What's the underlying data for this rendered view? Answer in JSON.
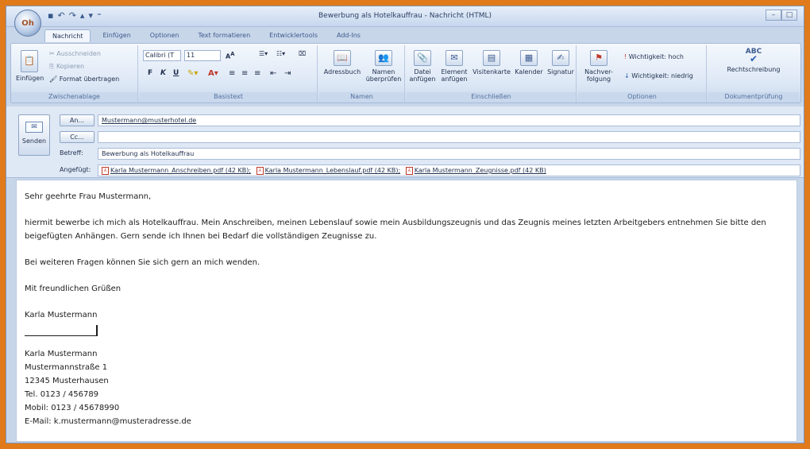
{
  "window": {
    "title": "Bewerbung als Hotelkauffrau - Nachricht (HTML)",
    "orb_label": "Oh"
  },
  "tabs": [
    "Nachricht",
    "Einfügen",
    "Optionen",
    "Text formatieren",
    "Entwicklertools",
    "Add-Ins"
  ],
  "ribbon": {
    "clipboard": {
      "paste": "Einfügen",
      "cut": "Ausschneiden",
      "copy": "Kopieren",
      "format_painter": "Format übertragen",
      "label": "Zwischenablage"
    },
    "basic_text": {
      "font_name": "Calibri (T",
      "font_size": "11",
      "bold": "F",
      "italic": "K",
      "underline": "U",
      "label": "Basistext"
    },
    "names": {
      "address_book": "Adressbuch",
      "check_names_1": "Namen",
      "check_names_2": "überprüfen",
      "label": "Namen"
    },
    "include": {
      "attach_file_1": "Datei",
      "attach_file_2": "anfügen",
      "attach_item_1": "Element",
      "attach_item_2": "anfügen",
      "business_card": "Visitenkarte",
      "calendar": "Kalender",
      "signature": "Signatur",
      "label": "Einschließen"
    },
    "options": {
      "follow_up_1": "Nachver-",
      "follow_up_2": "folgung",
      "high_importance": "Wichtigkeit: hoch",
      "low_importance": "Wichtigkeit: niedrig",
      "label": "Optionen"
    },
    "proofing": {
      "spelling": "Rechtschreibung",
      "abc": "ABC",
      "label": "Dokumentprüfung"
    }
  },
  "header": {
    "send_label": "Senden",
    "to_button": "An...",
    "cc_button": "Cc...",
    "subject_label": "Betreff:",
    "attached_label": "Angefügt:",
    "to_value": "Mustermann@musterhotel.de",
    "cc_value": "",
    "subject_value": "Bewerbung als Hotelkauffrau",
    "attachments": [
      "Karla Mustermann_Anschreiben.pdf (42 KB);",
      "Karla Mustermann_Lebenslauf.pdf (42 KB);",
      "Karla Mustermann_Zeugnisse.pdf (42 KB)"
    ]
  },
  "body": {
    "greeting": "Sehr geehrte Frau Mustermann,",
    "paragraph1": "hiermit bewerbe ich mich als Hotelkauffrau. Mein Anschreiben, meinen Lebenslauf sowie mein Ausbildungszeugnis und das Zeugnis meines letzten Arbeitgebers entnehmen Sie bitte den beigefügten Anhängen. Gern sende ich Ihnen bei Bedarf die vollständigen Zeugnisse zu.",
    "paragraph2": "Bei weiteren Fragen können Sie sich gern an mich wenden.",
    "closing": "Mit freundlichen Grüßen",
    "signature_name": "Karla Mustermann",
    "contact": [
      "Karla Mustermann",
      "Mustermannstraße 1",
      "12345 Musterhausen",
      "Tel. 0123 / 456789",
      "Mobil: 0123 / 45678990",
      "E-Mail: k.mustermann@musteradresse.de"
    ]
  }
}
